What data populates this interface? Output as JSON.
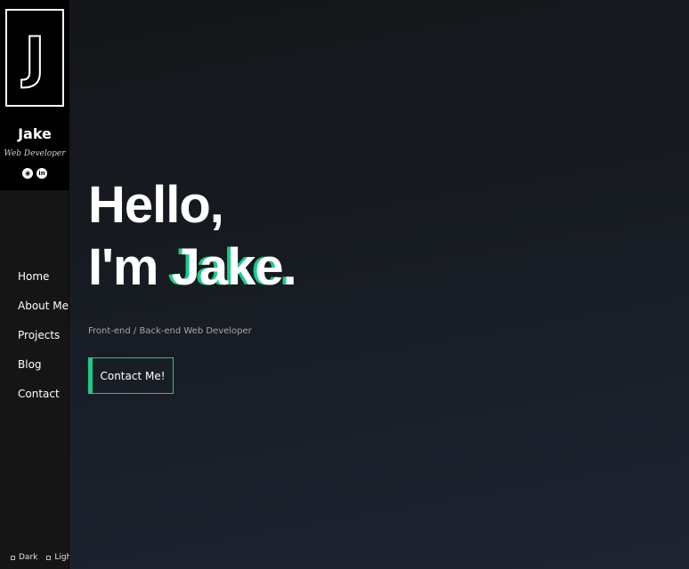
{
  "sidebar": {
    "logo_letter": "J",
    "name": "Jake",
    "role": "Web Developer",
    "social": [
      {
        "icon": "github-icon",
        "glyph": "◉"
      },
      {
        "icon": "linkedin-icon",
        "glyph": "in"
      }
    ],
    "nav": [
      "Home",
      "About Me",
      "Projects",
      "Blog",
      "Contact"
    ],
    "theme": {
      "dark": "Dark",
      "light": "Light"
    }
  },
  "hero": {
    "greeting": "Hello,",
    "intro_prefix": "I'm ",
    "intro_name": "Jake.",
    "subtitle": "Front-end / Back-end Web Developer",
    "cta_label": "Contact Me!"
  },
  "colors": {
    "accent": "#21c98a",
    "logo_shadow": "#e040b8",
    "background": "#141619"
  }
}
